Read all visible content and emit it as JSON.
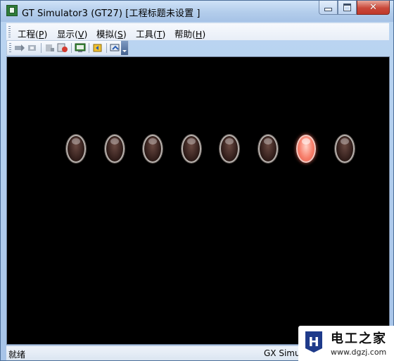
{
  "window": {
    "title": "GT Simulator3 (GT27)  [工程标题未设置 ]"
  },
  "menu": [
    {
      "label": "工程",
      "accel": "P"
    },
    {
      "label": "显示",
      "accel": "V"
    },
    {
      "label": "模拟",
      "accel": "S"
    },
    {
      "label": "工具",
      "accel": "T"
    },
    {
      "label": "帮助",
      "accel": "H"
    }
  ],
  "toolbar": {
    "icons": [
      "run-icon",
      "stop-icon",
      "print-icon",
      "settings-icon",
      "monitor-icon",
      "refresh-icon",
      "device-icon"
    ]
  },
  "lamps": {
    "count": 8,
    "states": [
      false,
      false,
      false,
      false,
      false,
      false,
      true,
      false
    ],
    "on_color": "#f7806c",
    "off_color": "#3a2420"
  },
  "status": {
    "left": "就绪",
    "right": "GX Simu"
  },
  "watermark": {
    "title": "电工之家",
    "url": "www.dgzj.com",
    "logo_letter": "H"
  }
}
